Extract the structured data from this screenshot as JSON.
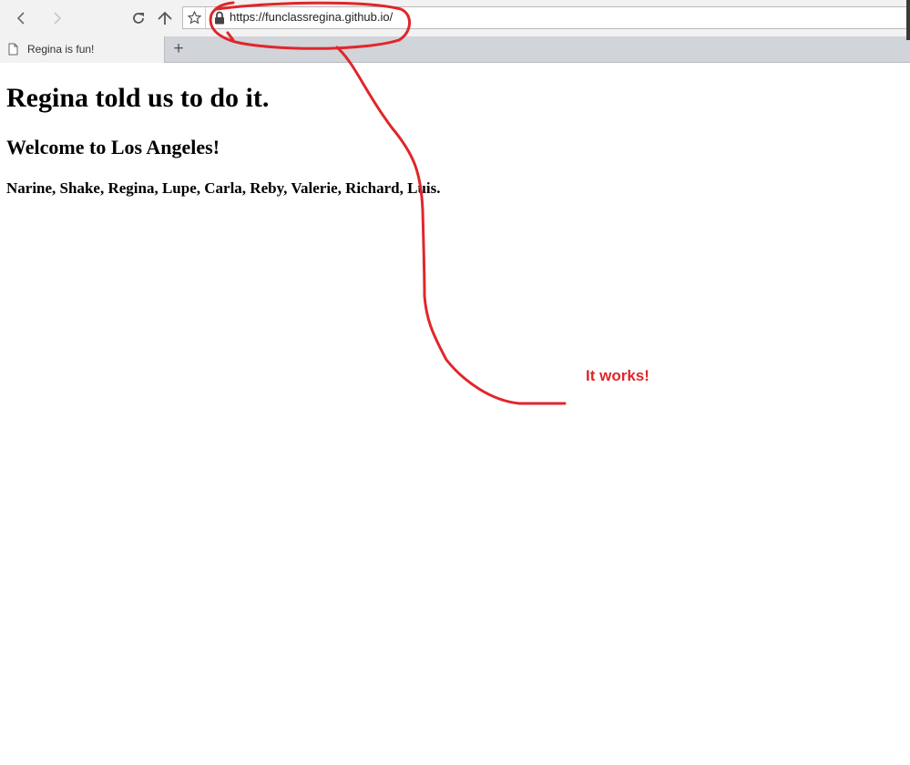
{
  "browser": {
    "tab": {
      "title": "Regina is fun!"
    },
    "address_bar": {
      "url": "https://funclassregina.github.io/"
    },
    "new_tab_label": "+"
  },
  "page": {
    "heading": "Regina told us to do it.",
    "subheading": "Welcome to Los Angeles!",
    "names": "Narine, Shake, Regina, Lupe, Carla, Reby, Valerie, Richard, Luis."
  },
  "annotation": {
    "note": "It works!",
    "color": "#e0262b"
  },
  "icons": {
    "back": "back-arrow-icon",
    "forward": "forward-arrow-icon",
    "reload": "reload-icon",
    "home": "home-icon",
    "bookmark": "star-icon",
    "secure": "lock-icon",
    "page": "page-icon"
  }
}
